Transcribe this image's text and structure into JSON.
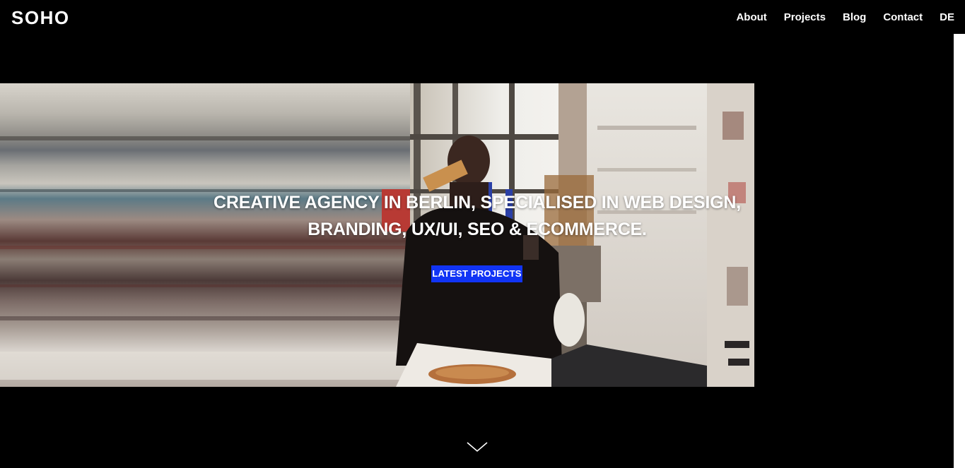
{
  "header": {
    "logo": "SOHO",
    "nav": [
      {
        "label": "About"
      },
      {
        "label": "Projects"
      },
      {
        "label": "Blog"
      },
      {
        "label": "Contact"
      },
      {
        "label": "DE"
      }
    ]
  },
  "hero": {
    "headline_line1": "CREATIVE AGENCY IN BERLIN, SPECIALISED IN WEB DESIGN,",
    "headline_line2": "BRANDING, UX/UI, SEO & ECOMMERCE.",
    "cta_label": "LATEST PROJECTS",
    "scroll_icon": "chevron-down-icon"
  },
  "colors": {
    "background": "#000000",
    "accent": "#1134f5",
    "text": "#ffffff"
  }
}
